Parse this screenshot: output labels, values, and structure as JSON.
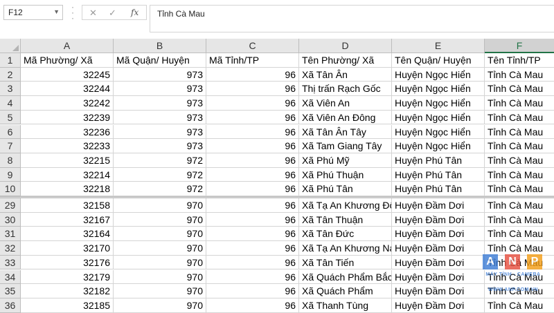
{
  "formula_bar": {
    "name_box": "F12",
    "formula_value": "Tỉnh Cà Mau",
    "cancel_icon": "✕",
    "enter_icon": "✓",
    "fx_label": "fx"
  },
  "columns": [
    "A",
    "B",
    "C",
    "D",
    "E",
    "F"
  ],
  "header_row": {
    "row_number": "1",
    "cells": [
      "Mã Phường/ Xã",
      "Mã Quận/ Huyện",
      "Mã Tỉnh/TP",
      "Tên Phường/ Xã",
      "Tên Quận/ Huyện",
      "Tên Tỉnh/TP"
    ]
  },
  "rows_top": [
    {
      "n": "2",
      "cells": [
        "32245",
        "973",
        "96",
        "Xã Tân Ân",
        "Huyện Ngọc Hiển",
        "Tỉnh Cà Mau"
      ]
    },
    {
      "n": "3",
      "cells": [
        "32244",
        "973",
        "96",
        "Thị trấn Rạch Gốc",
        "Huyện Ngọc Hiển",
        "Tỉnh Cà Mau"
      ]
    },
    {
      "n": "4",
      "cells": [
        "32242",
        "973",
        "96",
        "Xã Viên An",
        "Huyện Ngọc Hiển",
        "Tỉnh Cà Mau"
      ]
    },
    {
      "n": "5",
      "cells": [
        "32239",
        "973",
        "96",
        "Xã Viên An Đông",
        "Huyện Ngọc Hiển",
        "Tỉnh Cà Mau"
      ]
    },
    {
      "n": "6",
      "cells": [
        "32236",
        "973",
        "96",
        "Xã Tân Ân Tây",
        "Huyện Ngọc Hiển",
        "Tỉnh Cà Mau"
      ]
    },
    {
      "n": "7",
      "cells": [
        "32233",
        "973",
        "96",
        "Xã Tam Giang Tây",
        "Huyện Ngọc Hiển",
        "Tỉnh Cà Mau"
      ]
    },
    {
      "n": "8",
      "cells": [
        "32215",
        "972",
        "96",
        "Xã Phú Mỹ",
        "Huyện Phú Tân",
        "Tỉnh Cà Mau"
      ]
    },
    {
      "n": "9",
      "cells": [
        "32214",
        "972",
        "96",
        "Xã Phú Thuận",
        "Huyện Phú Tân",
        "Tỉnh Cà Mau"
      ]
    },
    {
      "n": "10",
      "cells": [
        "32218",
        "972",
        "96",
        "Xã Phú Tân",
        "Huyện Phú Tân",
        "Tỉnh Cà Mau"
      ]
    }
  ],
  "rows_bottom": [
    {
      "n": "29",
      "cells": [
        "32158",
        "970",
        "96",
        "Xã Tạ An Khương  Đông",
        "Huyện Đầm Dơi",
        "Tỉnh Cà Mau"
      ]
    },
    {
      "n": "30",
      "cells": [
        "32167",
        "970",
        "96",
        "Xã Tân Thuận",
        "Huyện Đầm Dơi",
        "Tỉnh Cà Mau"
      ]
    },
    {
      "n": "31",
      "cells": [
        "32164",
        "970",
        "96",
        "Xã Tân Đức",
        "Huyện Đầm Dơi",
        "Tỉnh Cà Mau"
      ]
    },
    {
      "n": "32",
      "cells": [
        "32170",
        "970",
        "96",
        "Xã Tạ An Khương  Nam",
        "Huyện Đầm Dơi",
        "Tỉnh Cà Mau"
      ]
    },
    {
      "n": "33",
      "cells": [
        "32176",
        "970",
        "96",
        "Xã Tân Tiến",
        "Huyện Đầm Dơi",
        "Tỉnh Cà Mau"
      ]
    },
    {
      "n": "34",
      "cells": [
        "32179",
        "970",
        "96",
        "Xã Quách Phẩm Bắc",
        "Huyện Đầm Dơi",
        "Tỉnh Cà Mau"
      ]
    },
    {
      "n": "35",
      "cells": [
        "32182",
        "970",
        "96",
        "Xã Quách Phẩm",
        "Huyện Đầm Dơi",
        "Tỉnh Cà Mau"
      ]
    },
    {
      "n": "36",
      "cells": [
        "32185",
        "970",
        "96",
        "Xã Thanh Tùng",
        "Huyện Đầm Dơi",
        "Tỉnh Cà Mau"
      ]
    }
  ],
  "watermark": {
    "letters": [
      "A",
      "N",
      "P"
    ],
    "line1": "MÁY TÍNH - CAMERA",
    "line2": "WWW.ANP.COM.VN",
    "colors": [
      "#3a7bd5",
      "#e74c3c",
      "#f39c12"
    ]
  },
  "theme": {
    "accent": "#217346",
    "header_bg": "#e6e6e6",
    "gridline": "#d4d4d4"
  }
}
